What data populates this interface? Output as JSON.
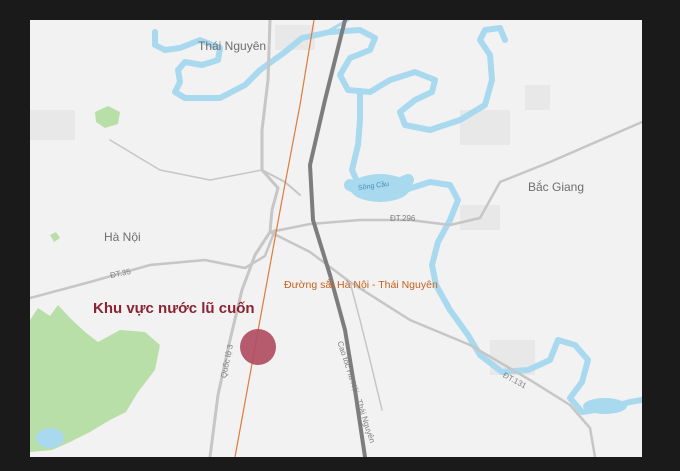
{
  "map": {
    "places": {
      "thai_nguyen": "Thái Nguyên",
      "bac_giang": "Bắc Giang",
      "ha_noi": "Hà Nội"
    },
    "roads": {
      "dt35": "ĐT.35",
      "dt296": "ĐT.296",
      "dt131": "ĐT.131",
      "ql3": "Quốc lộ 3",
      "expressway": "Cao tốc Hà Nội - Thái Nguyên"
    },
    "rivers": {
      "song_cau": "Sông Cầu"
    },
    "railway_label": "Đường sắt Hà Nội - Thái Nguyên",
    "flood_zone_label": "Khu vực nước lũ cuốn",
    "colors": {
      "background": "#f2f2f2",
      "water": "#a9d9ef",
      "forest": "#b9dfa9",
      "road": "#c6c6c6",
      "expressway": "#7d7d7d",
      "railway": "#e07a3a",
      "flood_marker": "#b14d63",
      "flood_text": "#8b2333"
    }
  }
}
